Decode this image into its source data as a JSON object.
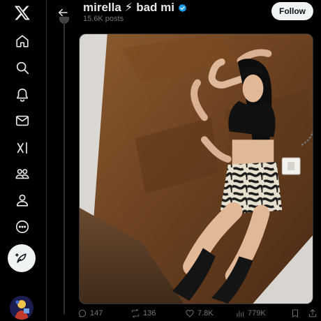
{
  "profile": {
    "display_name": "mirella ⚡ bad mi",
    "post_count": "15.6K posts"
  },
  "header": {
    "follow_label": "Follow"
  },
  "nav": {
    "icons": [
      "x-logo-icon",
      "home-icon",
      "explore-icon",
      "notifications-icon",
      "messages-icon",
      "grok-icon",
      "communities-icon",
      "profile-icon",
      "more-icon",
      "compose-icon"
    ]
  },
  "actions": {
    "replies": "147",
    "reposts": "136",
    "likes": "7.8K",
    "views": "779K"
  },
  "colors": {
    "background": "#000000",
    "text": "#e7e9ea",
    "muted": "#71767b",
    "verified": "#1d9bf0",
    "follow_bg": "#eff3f4"
  }
}
